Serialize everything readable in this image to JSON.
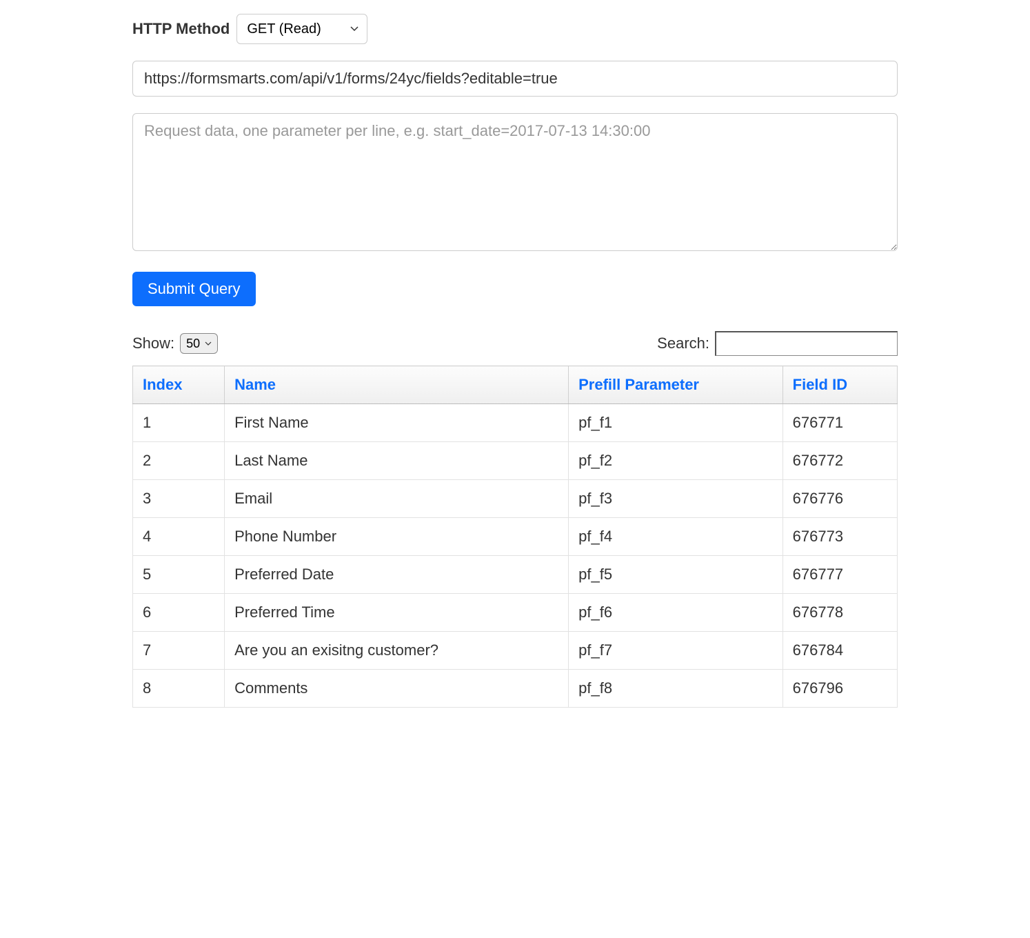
{
  "http_method": {
    "label": "HTTP Method",
    "selected": "GET (Read)"
  },
  "url_input": {
    "value": "https://formsmarts.com/api/v1/forms/24yc/fields?editable=true"
  },
  "request_data": {
    "placeholder": "Request data, one parameter per line, e.g. start_date=2017-07-13 14:30:00",
    "value": ""
  },
  "submit_button": {
    "label": "Submit Query"
  },
  "show": {
    "label": "Show:",
    "selected": "50"
  },
  "search": {
    "label": "Search:",
    "value": ""
  },
  "table": {
    "headers": {
      "index": "Index",
      "name": "Name",
      "prefill": "Prefill Parameter",
      "field_id": "Field ID"
    },
    "rows": [
      {
        "index": "1",
        "name": "First Name",
        "prefill": "pf_f1",
        "field_id": "676771"
      },
      {
        "index": "2",
        "name": "Last Name",
        "prefill": "pf_f2",
        "field_id": "676772"
      },
      {
        "index": "3",
        "name": "Email",
        "prefill": "pf_f3",
        "field_id": "676776"
      },
      {
        "index": "4",
        "name": "Phone Number",
        "prefill": "pf_f4",
        "field_id": "676773"
      },
      {
        "index": "5",
        "name": "Preferred Date",
        "prefill": "pf_f5",
        "field_id": "676777"
      },
      {
        "index": "6",
        "name": "Preferred Time",
        "prefill": "pf_f6",
        "field_id": "676778"
      },
      {
        "index": "7",
        "name": "Are you an exisitng customer?",
        "prefill": "pf_f7",
        "field_id": "676784"
      },
      {
        "index": "8",
        "name": "Comments",
        "prefill": "pf_f8",
        "field_id": "676796"
      }
    ]
  }
}
